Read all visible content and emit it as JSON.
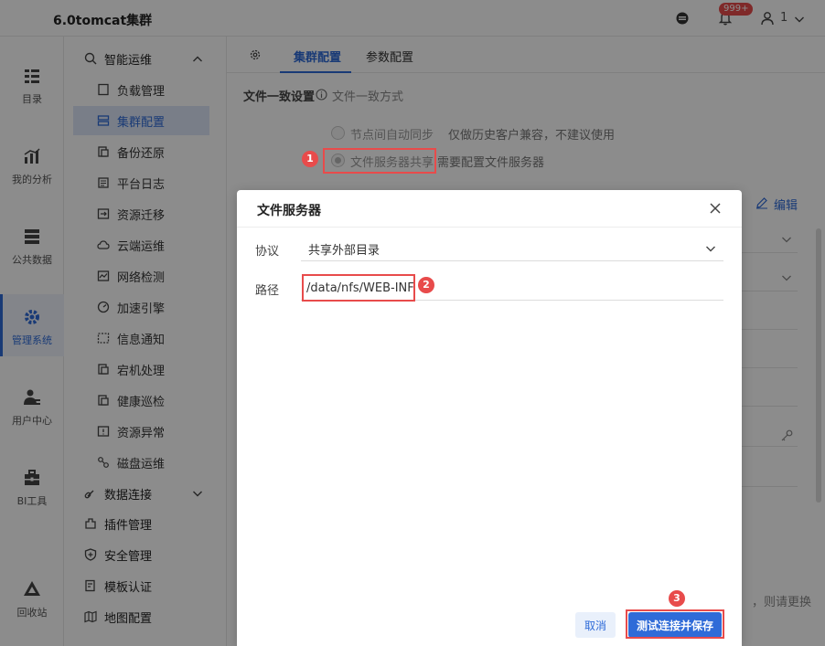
{
  "app": {
    "title": "6.0tomcat集群",
    "notification_count": "999+",
    "user": "1"
  },
  "rail": [
    {
      "label": "目录",
      "icon": "directory-icon"
    },
    {
      "label": "我的分析",
      "icon": "analysis-icon"
    },
    {
      "label": "公共数据",
      "icon": "public-data-icon"
    },
    {
      "label": "管理系统",
      "icon": "manage-system-icon",
      "active": true
    },
    {
      "label": "用户中心",
      "icon": "user-center-icon"
    },
    {
      "label": "BI工具",
      "icon": "bi-tools-icon"
    },
    {
      "label": "回收站",
      "icon": "recycle-bin-icon"
    }
  ],
  "nav": {
    "group_ops": "智能运维",
    "items": [
      "负载管理",
      "集群配置",
      "备份还原",
      "平台日志",
      "资源迁移",
      "云端运维",
      "网络检测",
      "加速引擎",
      "信息通知",
      "宕机处理",
      "健康巡检",
      "资源异常",
      "磁盘运维"
    ],
    "active_item": "集群配置",
    "groups": [
      "数据连接",
      "插件管理",
      "安全管理",
      "模板认证",
      "地图配置"
    ]
  },
  "main": {
    "tabs": [
      "集群配置",
      "参数配置"
    ],
    "section_title": "文件一致设置",
    "section_sub": "文件一致方式",
    "option1": "节点间自动同步",
    "option1_note": "仅做历史客户兼容，不建议使用",
    "option2": "文件服务器共享",
    "option2_note": "需要配置文件服务器",
    "edit_label": "编辑",
    "right_clip": "，则请更换"
  },
  "modal": {
    "title": "文件服务器",
    "protocol_label": "协议",
    "protocol_value": "共享外部目录",
    "path_label": "路径",
    "path_value": "/data/nfs/WEB-INF",
    "cancel": "取消",
    "save": "测试连接并保存"
  },
  "callouts": [
    "1",
    "2",
    "3"
  ],
  "colors": {
    "accent": "#2f6bd8",
    "highlight": "#e84b4b"
  }
}
